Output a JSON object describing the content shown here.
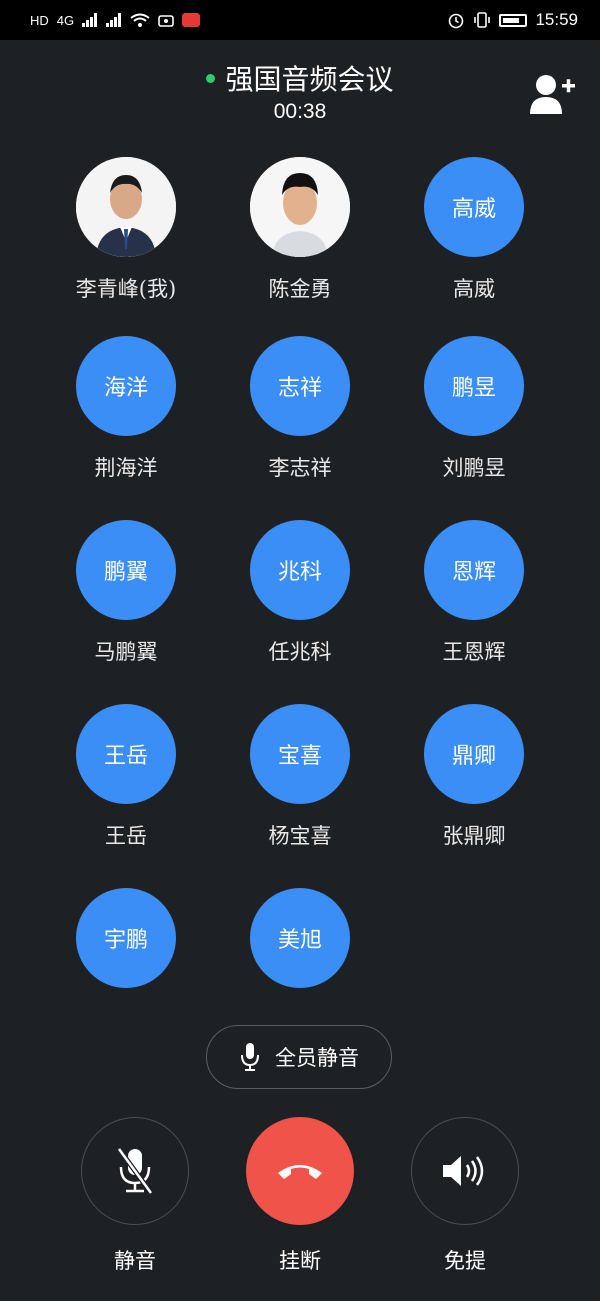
{
  "status_bar": {
    "left_glyphs": [
      "HD",
      "4G",
      "HD",
      "4G"
    ],
    "time": "15:59",
    "icons": [
      "signal-icon",
      "wifi-icon",
      "notification-icon",
      "camera-record-icon",
      "alarm-icon",
      "vibrate-icon",
      "battery-icon"
    ]
  },
  "header": {
    "title": "强国音频会议",
    "timer": "00:38",
    "add_icon": "add-person-icon",
    "live_color": "#2ecc71"
  },
  "participants": [
    {
      "name": "李青峰(我)",
      "avatar_text": "",
      "photo": true
    },
    {
      "name": "陈金勇",
      "avatar_text": "",
      "photo": true
    },
    {
      "name": "高威",
      "avatar_text": "高威",
      "photo": false
    },
    {
      "name": "荆海洋",
      "avatar_text": "海洋",
      "photo": false
    },
    {
      "name": "李志祥",
      "avatar_text": "志祥",
      "photo": false
    },
    {
      "name": "刘鹏昱",
      "avatar_text": "鹏昱",
      "photo": false
    },
    {
      "name": "马鹏翼",
      "avatar_text": "鹏翼",
      "photo": false
    },
    {
      "name": "任兆科",
      "avatar_text": "兆科",
      "photo": false
    },
    {
      "name": "王恩辉",
      "avatar_text": "恩辉",
      "photo": false
    },
    {
      "name": "王岳",
      "avatar_text": "王岳",
      "photo": false
    },
    {
      "name": "杨宝喜",
      "avatar_text": "宝喜",
      "photo": false
    },
    {
      "name": "张鼎卿",
      "avatar_text": "鼎卿",
      "photo": false
    },
    {
      "name": "",
      "avatar_text": "宇鹏",
      "photo": false
    },
    {
      "name": "",
      "avatar_text": "美旭",
      "photo": false
    }
  ],
  "mute_all": {
    "label": "全员静音",
    "icon": "microphone-icon"
  },
  "controls": {
    "mute": {
      "label": "静音",
      "icon": "microphone-off-icon"
    },
    "hangup": {
      "label": "挂断",
      "icon": "hang-up-icon"
    },
    "speaker": {
      "label": "免提",
      "icon": "speaker-icon"
    }
  },
  "colors": {
    "accent": "#3a8ef6",
    "hangup": "#f0534a",
    "background": "#1e2124"
  }
}
